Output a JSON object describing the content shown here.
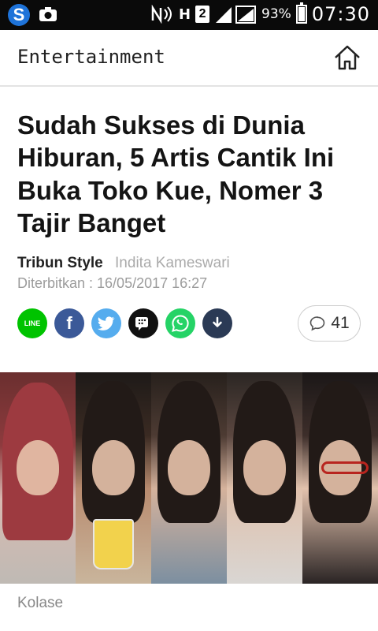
{
  "status_bar": {
    "network_type": "H",
    "sim_slot": "2",
    "battery": "93%",
    "time": "07:30",
    "icons": [
      "app-s-icon",
      "camera-app-icon",
      "nfc-icon",
      "signal-icon",
      "battery-icon"
    ]
  },
  "header": {
    "section": "Entertainment",
    "home_icon": "home-icon"
  },
  "article": {
    "headline": "Sudah Sukses di Dunia Hiburan, 5 Artis Cantik Ini Buka Toko Kue, Nomer 3 Tajir Banget",
    "source": "Tribun Style",
    "author": "Indita Kameswari",
    "published": "Diterbitkan : 16/05/2017 16:27",
    "image_caption": "Kolase"
  },
  "share": {
    "line_label": "LINE",
    "facebook_label": "f",
    "bbm_label": "bbm",
    "colors": {
      "line": "#00c300",
      "facebook": "#3b5998",
      "twitter": "#55acee",
      "bbm": "#111111",
      "whatsapp": "#25d366",
      "download": "#2b3a55"
    }
  },
  "comments": {
    "count": "41",
    "icon": "comment-bubble-icon"
  }
}
